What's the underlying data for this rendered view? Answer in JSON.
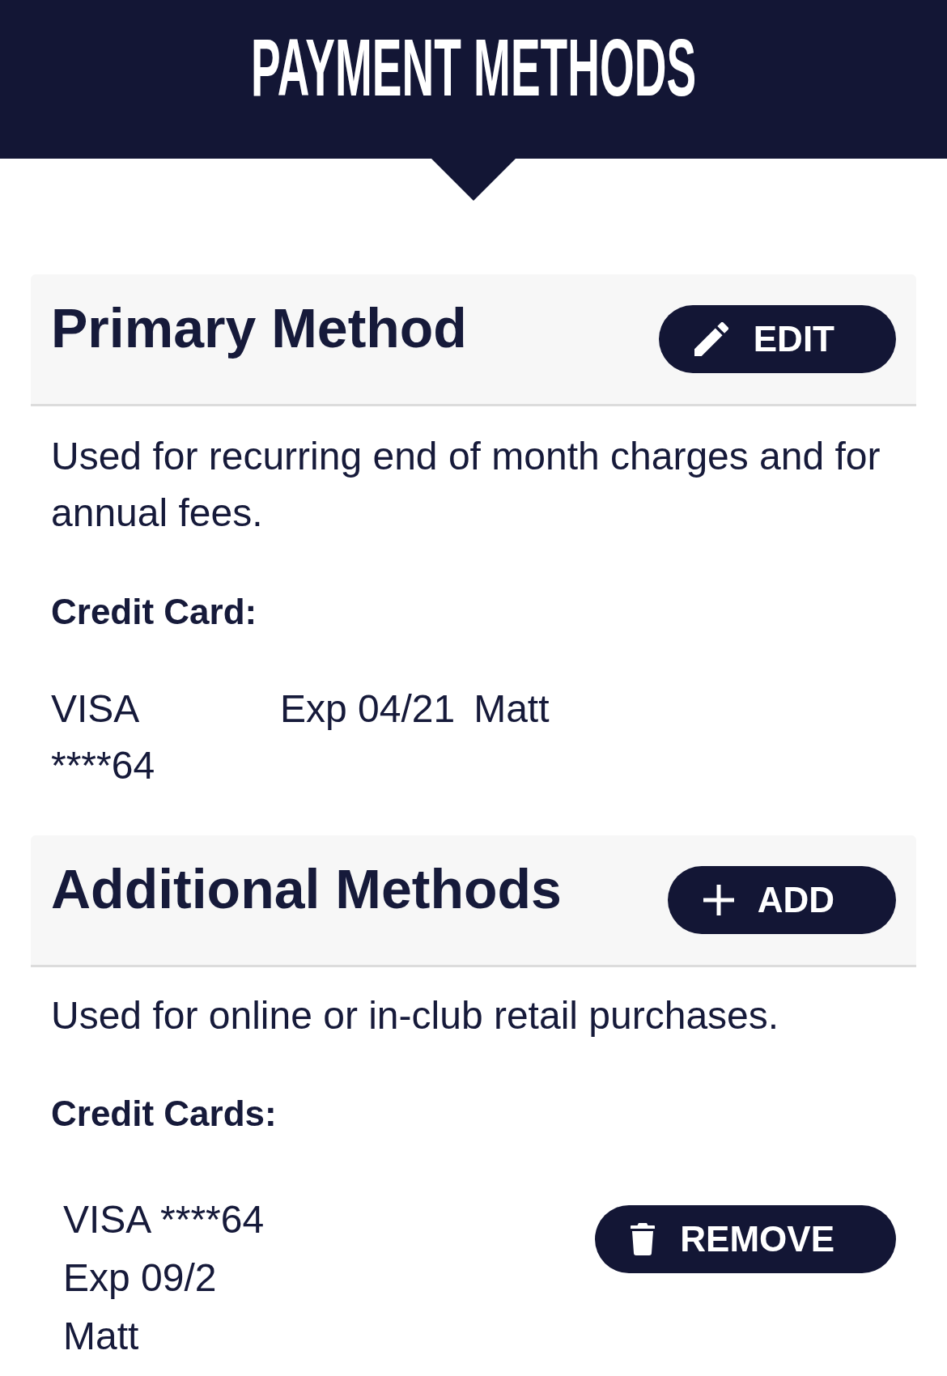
{
  "header": {
    "title": "PAYMENT METHODS"
  },
  "sections": [
    {
      "kind": "primary",
      "title": "Primary Method",
      "button": "EDIT",
      "description": "Used for recurring end of month charges and for annual fees.",
      "cards_label": "Credit Card:",
      "cards": [
        {
          "number": "VISA ****64",
          "expiry": "Exp 04/21",
          "holder": "Matt"
        }
      ]
    },
    {
      "kind": "additional",
      "title": "Additional Methods",
      "button": "ADD",
      "description": "Used for online or in-club retail purchases.",
      "cards_label": "Credit Cards:",
      "cards": [
        {
          "number": "VISA ****64",
          "expiry": "Exp 09/2",
          "holder": "Matt",
          "button": "REMOVE"
        }
      ]
    }
  ]
}
